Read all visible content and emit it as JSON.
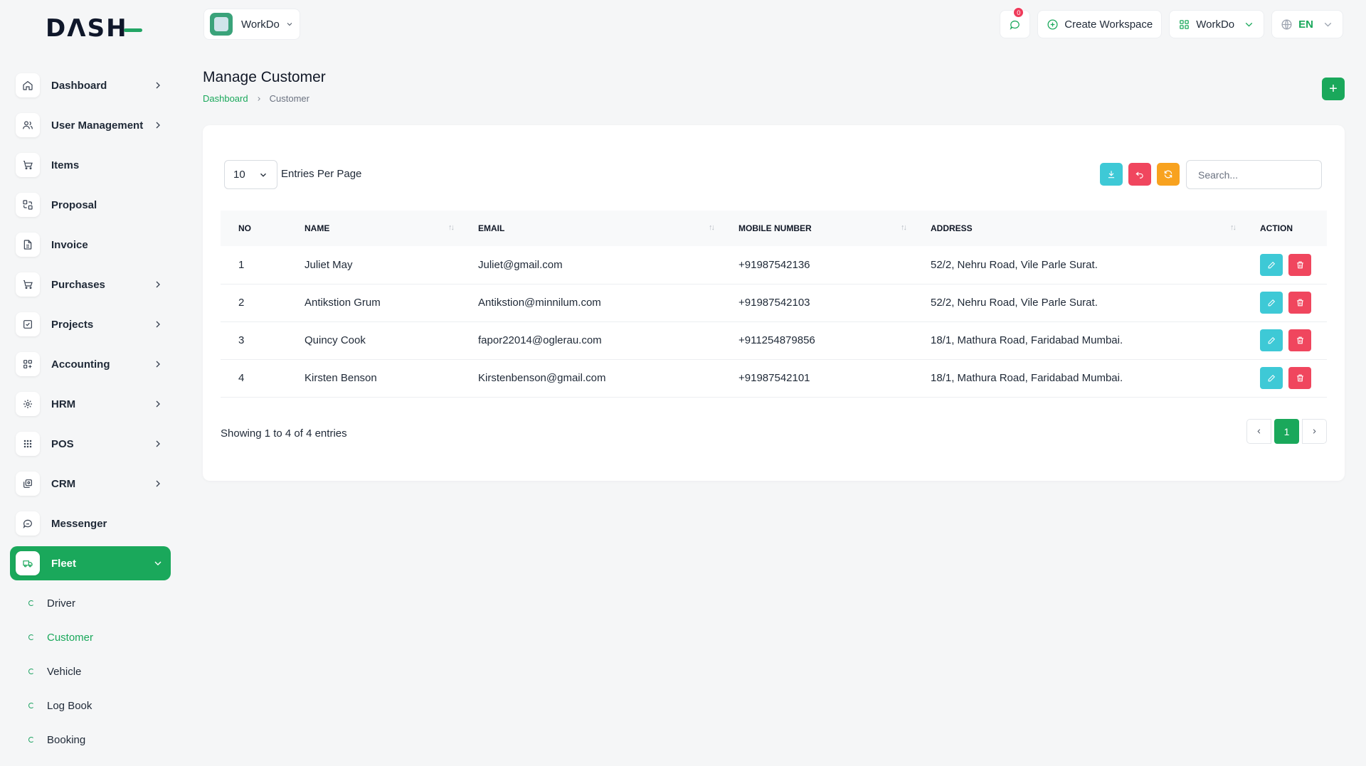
{
  "brand": {
    "logo_text": "DASH"
  },
  "sidebar": {
    "items": [
      {
        "label": "Dashboard",
        "icon": "home-icon",
        "has_children": true
      },
      {
        "label": "User Management",
        "icon": "users-icon",
        "has_children": true
      },
      {
        "label": "Items",
        "icon": "cart-icon",
        "has_children": false
      },
      {
        "label": "Proposal",
        "icon": "proposal-icon",
        "has_children": false
      },
      {
        "label": "Invoice",
        "icon": "file-icon",
        "has_children": false
      },
      {
        "label": "Purchases",
        "icon": "cart-icon",
        "has_children": true
      },
      {
        "label": "Projects",
        "icon": "checkbox-icon",
        "has_children": true
      },
      {
        "label": "Accounting",
        "icon": "grid-icon",
        "has_children": true
      },
      {
        "label": "HRM",
        "icon": "hrm-icon",
        "has_children": true
      },
      {
        "label": "POS",
        "icon": "dots-grid-icon",
        "has_children": true
      },
      {
        "label": "CRM",
        "icon": "crm-icon",
        "has_children": true
      },
      {
        "label": "Messenger",
        "icon": "chat-icon",
        "has_children": false
      },
      {
        "label": "Fleet",
        "icon": "truck-icon",
        "has_children": true,
        "active": true
      }
    ],
    "fleet_sub": [
      {
        "label": "Driver"
      },
      {
        "label": "Customer",
        "active": true
      },
      {
        "label": "Vehicle"
      },
      {
        "label": "Log Book"
      },
      {
        "label": "Booking"
      }
    ]
  },
  "topbar": {
    "workspace_name": "WorkDo",
    "notification_count": "0",
    "create_workspace_label": "Create Workspace",
    "workspace_menu_label": "WorkDo",
    "language": "EN"
  },
  "page": {
    "title": "Manage Customer",
    "breadcrumb": {
      "home": "Dashboard",
      "current": "Customer"
    },
    "add_button": "+"
  },
  "table_controls": {
    "per_page_value": "10",
    "per_page_label": "Entries Per Page",
    "search_placeholder": "Search..."
  },
  "colors": {
    "accent": "#1aa85b",
    "export_tool": "#3ec9d6",
    "reset_tool": "#f0465e",
    "refresh_tool": "#f8a21f"
  },
  "table": {
    "headers": [
      "NO",
      "NAME",
      "EMAIL",
      "MOBILE NUMBER",
      "ADDRESS",
      "ACTION"
    ],
    "rows": [
      {
        "no": "1",
        "name": "Juliet May",
        "email": "Juliet@gmail.com",
        "mobile": "+91987542136",
        "address": "52/2, Nehru Road, Vile Parle Surat."
      },
      {
        "no": "2",
        "name": "Antikstion Grum",
        "email": "Antikstion@minnilum.com",
        "mobile": "+91987542103",
        "address": "52/2, Nehru Road, Vile Parle Surat."
      },
      {
        "no": "3",
        "name": "Quincy Cook",
        "email": "fapor22014@oglerau.com",
        "mobile": "+911254879856",
        "address": "18/1, Mathura Road, Faridabad Mumbai."
      },
      {
        "no": "4",
        "name": "Kirsten Benson",
        "email": "Kirstenbenson@gmail.com",
        "mobile": "+91987542101",
        "address": "18/1, Mathura Road, Faridabad Mumbai."
      }
    ]
  },
  "footer": {
    "showing": "Showing 1 to 4 of 4 entries",
    "current_page": "1"
  }
}
